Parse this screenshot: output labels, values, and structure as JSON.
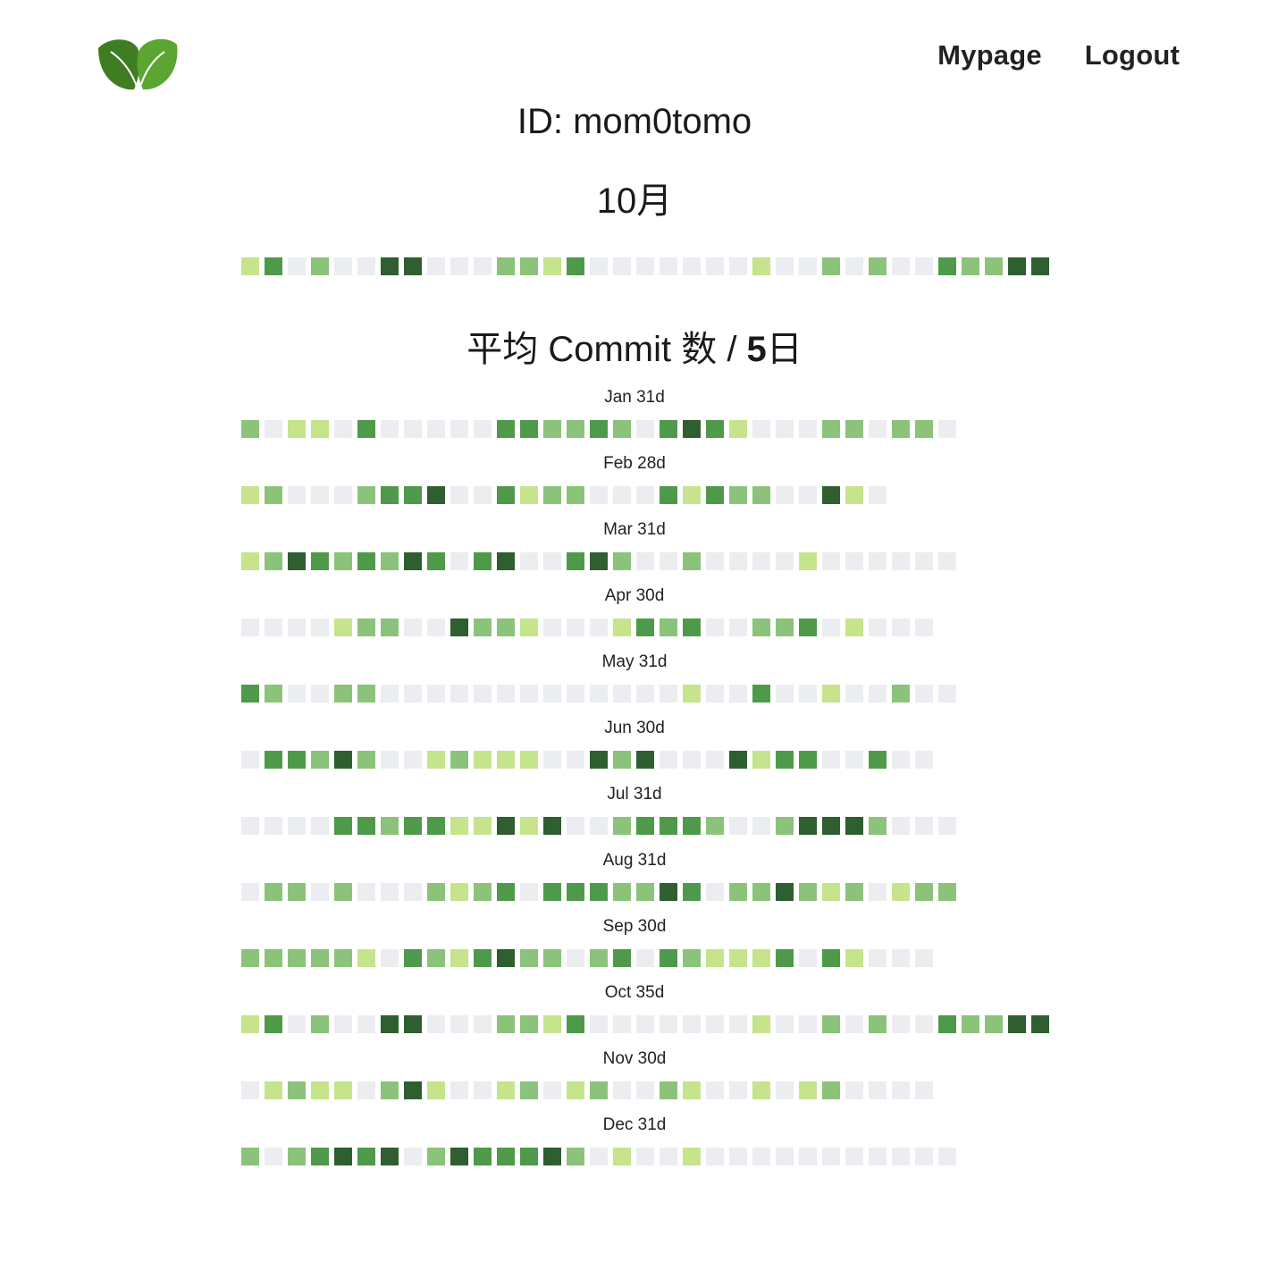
{
  "header": {
    "logo_alt": "leaf-logo",
    "nav": {
      "mypage": "Mypage",
      "logout": "Logout"
    }
  },
  "profile": {
    "id_text": "ID: mom0tomo"
  },
  "current_month": {
    "title": "10月",
    "levels": [
      1,
      3,
      0,
      2,
      0,
      0,
      4,
      4,
      0,
      0,
      0,
      2,
      2,
      1,
      3,
      0,
      0,
      0,
      0,
      0,
      0,
      0,
      1,
      0,
      0,
      2,
      0,
      2,
      0,
      0,
      3,
      2,
      2,
      4,
      4
    ]
  },
  "average": {
    "prefix": "平均 Commit 数 / ",
    "value": "5",
    "suffix": "日"
  },
  "palette": {
    "0": "#ebedf0",
    "1": "#c6e48b",
    "2": "#8bc37a",
    "3": "#4f9a4a",
    "4": "#2f5e30"
  },
  "months": [
    {
      "label": "Jan 31d",
      "levels": [
        2,
        0,
        1,
        1,
        0,
        3,
        0,
        0,
        0,
        0,
        0,
        3,
        3,
        2,
        2,
        3,
        2,
        0,
        3,
        4,
        3,
        1,
        0,
        0,
        0,
        2,
        2,
        0,
        2,
        2,
        0
      ]
    },
    {
      "label": "Feb 28d",
      "levels": [
        1,
        2,
        0,
        0,
        0,
        2,
        3,
        3,
        4,
        0,
        0,
        3,
        1,
        2,
        2,
        0,
        0,
        0,
        3,
        1,
        3,
        2,
        2,
        0,
        0,
        4,
        1,
        0
      ]
    },
    {
      "label": "Mar 31d",
      "levels": [
        1,
        2,
        4,
        3,
        2,
        3,
        2,
        4,
        3,
        0,
        3,
        4,
        0,
        0,
        3,
        4,
        2,
        0,
        0,
        2,
        0,
        0,
        0,
        0,
        1,
        0,
        0,
        0,
        0,
        0,
        0
      ]
    },
    {
      "label": "Apr 30d",
      "levels": [
        0,
        0,
        0,
        0,
        1,
        2,
        2,
        0,
        0,
        4,
        2,
        2,
        1,
        0,
        0,
        0,
        1,
        3,
        2,
        3,
        0,
        0,
        2,
        2,
        3,
        0,
        1,
        0,
        0,
        0
      ]
    },
    {
      "label": "May 31d",
      "levels": [
        3,
        2,
        0,
        0,
        2,
        2,
        0,
        0,
        0,
        0,
        0,
        0,
        0,
        0,
        0,
        0,
        0,
        0,
        0,
        1,
        0,
        0,
        3,
        0,
        0,
        1,
        0,
        0,
        2,
        0,
        0
      ]
    },
    {
      "label": "Jun 30d",
      "levels": [
        0,
        3,
        3,
        2,
        4,
        2,
        0,
        0,
        1,
        2,
        1,
        1,
        1,
        0,
        0,
        4,
        2,
        4,
        0,
        0,
        0,
        4,
        1,
        3,
        3,
        0,
        0,
        3,
        0,
        0
      ]
    },
    {
      "label": "Jul 31d",
      "levels": [
        0,
        0,
        0,
        0,
        3,
        3,
        2,
        3,
        3,
        1,
        1,
        4,
        1,
        4,
        0,
        0,
        2,
        3,
        3,
        3,
        2,
        0,
        0,
        2,
        4,
        4,
        4,
        2,
        0,
        0,
        0
      ]
    },
    {
      "label": "Aug 31d",
      "levels": [
        0,
        2,
        2,
        0,
        2,
        0,
        0,
        0,
        2,
        1,
        2,
        3,
        0,
        3,
        3,
        3,
        2,
        2,
        4,
        3,
        0,
        2,
        2,
        4,
        2,
        1,
        2,
        0,
        1,
        2,
        2
      ]
    },
    {
      "label": "Sep 30d",
      "levels": [
        2,
        2,
        2,
        2,
        2,
        1,
        0,
        3,
        2,
        1,
        3,
        4,
        2,
        2,
        0,
        2,
        3,
        0,
        3,
        2,
        1,
        1,
        1,
        3,
        0,
        3,
        1,
        0,
        0,
        0
      ]
    },
    {
      "label": "Oct 35d",
      "levels": [
        1,
        3,
        0,
        2,
        0,
        0,
        4,
        4,
        0,
        0,
        0,
        2,
        2,
        1,
        3,
        0,
        0,
        0,
        0,
        0,
        0,
        0,
        1,
        0,
        0,
        2,
        0,
        2,
        0,
        0,
        3,
        2,
        2,
        4,
        4
      ]
    },
    {
      "label": "Nov 30d",
      "levels": [
        0,
        1,
        2,
        1,
        1,
        0,
        2,
        4,
        1,
        0,
        0,
        1,
        2,
        0,
        1,
        2,
        0,
        0,
        2,
        1,
        0,
        0,
        1,
        0,
        1,
        2,
        0,
        0,
        0,
        0
      ]
    },
    {
      "label": "Dec 31d",
      "levels": [
        2,
        0,
        2,
        3,
        4,
        3,
        4,
        0,
        2,
        4,
        3,
        3,
        3,
        4,
        2,
        0,
        1,
        0,
        0,
        1,
        0,
        0,
        0,
        0,
        0,
        0,
        0,
        0,
        0,
        0,
        0
      ]
    }
  ]
}
